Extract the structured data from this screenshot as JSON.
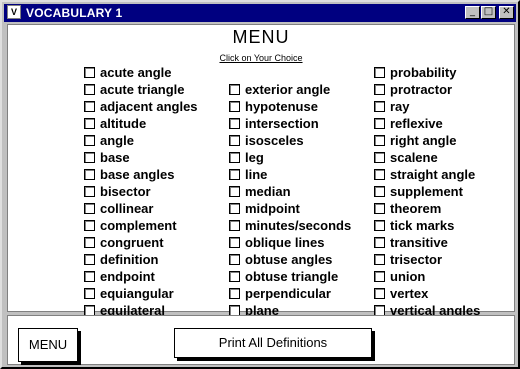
{
  "window": {
    "title": "VOCABULARY 1",
    "minimize": "_",
    "maximize": "□",
    "close": "✕",
    "app_icon": "V"
  },
  "header": {
    "title": "MENU",
    "subtitle": "Click on Your Choice"
  },
  "columns": [
    [
      "acute angle",
      "acute triangle",
      "adjacent angles",
      "altitude",
      "angle",
      "base",
      "base angles",
      "bisector",
      "collinear",
      "complement",
      "congruent",
      "definition",
      "endpoint",
      "equiangular",
      "equilateral"
    ],
    [
      "exterior angle",
      "hypotenuse",
      "intersection",
      "isosceles",
      "leg",
      "line",
      "median",
      "midpoint",
      "minutes/seconds",
      "oblique lines",
      "obtuse angles",
      "obtuse triangle",
      "perpendicular",
      "plane"
    ],
    [
      "probability",
      "protractor",
      "ray",
      "reflexive",
      "right angle",
      "scalene",
      "straight angle",
      "supplement",
      "theorem",
      "tick marks",
      "transitive",
      "trisector",
      "union",
      "vertex",
      "vertical angles"
    ]
  ],
  "buttons": {
    "menu": "MENU",
    "print_all": "Print All Definitions"
  }
}
